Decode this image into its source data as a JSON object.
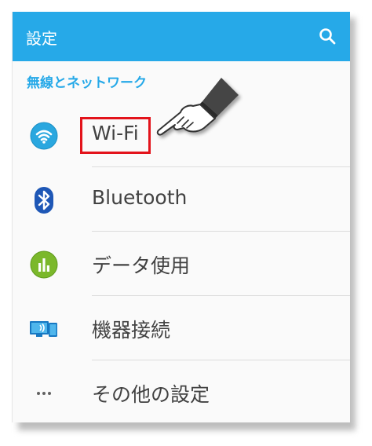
{
  "appbar": {
    "title": "設定"
  },
  "section": {
    "header": "無線とネットワーク"
  },
  "items": [
    {
      "label": "Wi-Fi",
      "icon": "wifi-icon"
    },
    {
      "label": "Bluetooth",
      "icon": "bluetooth-icon"
    },
    {
      "label": "データ使用",
      "icon": "data-usage-icon"
    },
    {
      "label": "機器接続",
      "icon": "device-connection-icon"
    },
    {
      "label": "その他の設定",
      "icon": "more-icon"
    }
  ],
  "colors": {
    "accent": "#26a9e8",
    "highlight": "#e3131b",
    "text": "#424242"
  }
}
